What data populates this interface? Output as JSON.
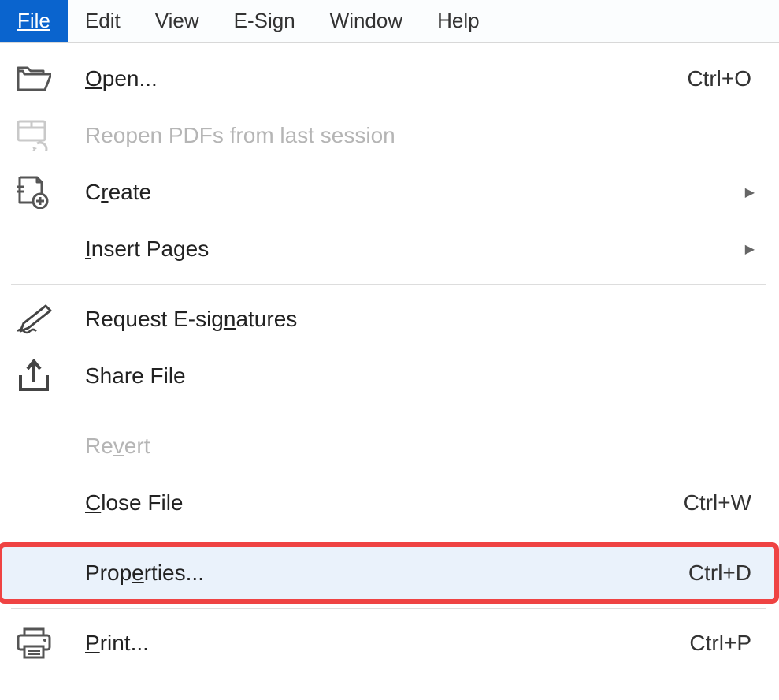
{
  "menubar": {
    "items": [
      {
        "label": "File",
        "mnemonic": "F",
        "active": true
      },
      {
        "label": "Edit",
        "mnemonic": "E",
        "active": false
      },
      {
        "label": "View",
        "mnemonic": "V",
        "active": false
      },
      {
        "label": "E-Sign",
        "mnemonic": null,
        "active": false
      },
      {
        "label": "Window",
        "mnemonic": "W",
        "active": false
      },
      {
        "label": "Help",
        "mnemonic": "H",
        "active": false
      }
    ]
  },
  "menu": {
    "open": {
      "label": "Open...",
      "mnemonic": "O",
      "shortcut": "Ctrl+O"
    },
    "reopen": {
      "label": "Reopen PDFs from last session",
      "mnemonic": null,
      "disabled": true
    },
    "create": {
      "label": "Create",
      "mnemonic": "r",
      "submenu": true
    },
    "insert": {
      "label": "Insert Pages",
      "mnemonic": "I",
      "submenu": true
    },
    "reqsig": {
      "label": "Request E-signatures",
      "mnemonic": "n"
    },
    "share": {
      "label": "Share File",
      "mnemonic": null
    },
    "revert": {
      "label": "Revert",
      "mnemonic": "v",
      "disabled": true
    },
    "close": {
      "label": "Close File",
      "mnemonic": "C",
      "shortcut": "Ctrl+W"
    },
    "properties": {
      "label": "Properties...",
      "mnemonic": "e",
      "shortcut": "Ctrl+D",
      "highlight": true
    },
    "print": {
      "label": "Print...",
      "mnemonic": "P",
      "shortcut": "Ctrl+P"
    }
  }
}
